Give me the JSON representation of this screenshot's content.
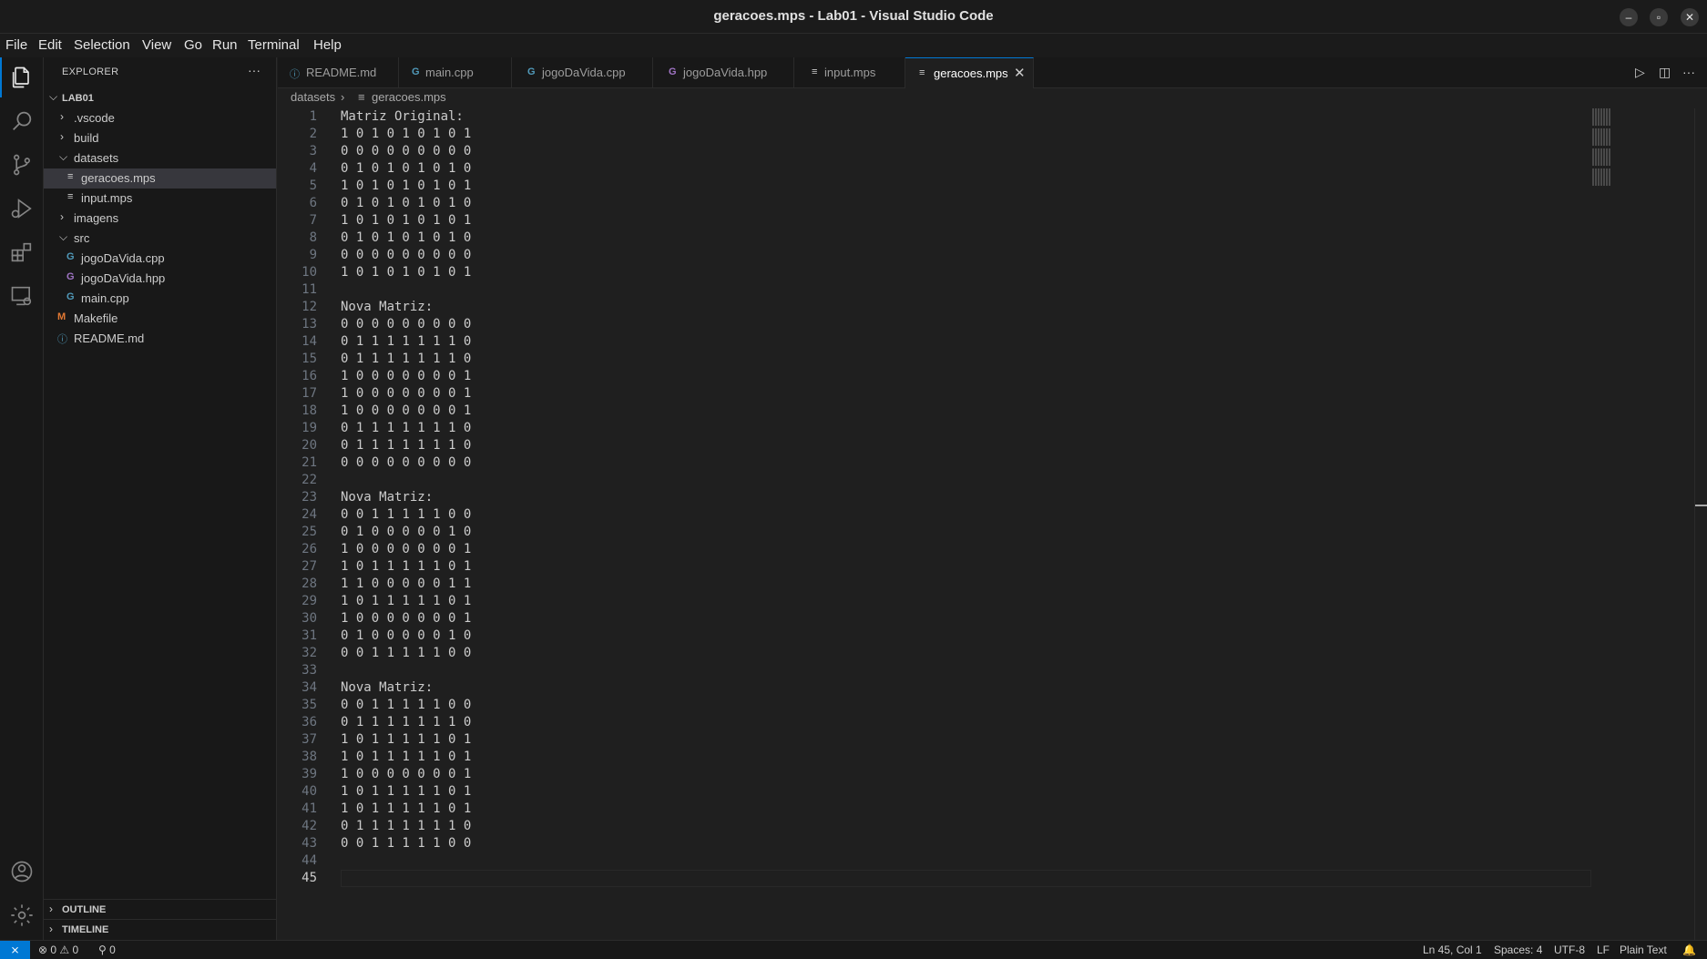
{
  "window": {
    "title": "geracoes.mps - Lab01 - Visual Studio Code",
    "controls": [
      "–",
      "▫",
      "✕"
    ]
  },
  "menu": [
    "File",
    "Edit",
    "Selection",
    "View",
    "Go",
    "Run",
    "Terminal",
    "Help"
  ],
  "activity_bar": [
    "files-icon",
    "search-icon",
    "source-control-icon",
    "run-debug-icon",
    "extensions-icon",
    "remote-explorer-icon",
    "accounts-icon",
    "settings-gear-icon"
  ],
  "sidebar": {
    "header": "EXPLORER",
    "more": "···",
    "root": "LAB01",
    "items": [
      {
        "label": ".vscode",
        "type": "folder",
        "expanded": false
      },
      {
        "label": "build",
        "type": "folder",
        "expanded": false
      },
      {
        "label": "datasets",
        "type": "folder",
        "expanded": true
      },
      {
        "label": "geracoes.mps",
        "type": "file",
        "icon": "≡",
        "selected": true
      },
      {
        "label": "input.mps",
        "type": "file",
        "icon": "≡"
      },
      {
        "label": "imagens",
        "type": "folder",
        "expanded": false
      },
      {
        "label": "src",
        "type": "folder",
        "expanded": true
      },
      {
        "label": "jogoDaVida.cpp",
        "type": "file",
        "icon": "G"
      },
      {
        "label": "jogoDaVida.hpp",
        "type": "file",
        "icon": "G"
      },
      {
        "label": "main.cpp",
        "type": "file",
        "icon": "G"
      },
      {
        "label": "Makefile",
        "type": "file",
        "icon": "M"
      },
      {
        "label": "README.md",
        "type": "file",
        "icon": "ⓘ"
      }
    ],
    "sections": [
      "OUTLINE",
      "TIMELINE"
    ]
  },
  "tabs": [
    {
      "label": "README.md",
      "icon": "ⓘ",
      "active": false
    },
    {
      "label": "main.cpp",
      "icon": "G",
      "active": false
    },
    {
      "label": "jogoDaVida.cpp",
      "icon": "G",
      "active": false
    },
    {
      "label": "jogoDaVida.hpp",
      "icon": "G",
      "active": false
    },
    {
      "label": "input.mps",
      "icon": "≡",
      "active": false
    },
    {
      "label": "geracoes.mps",
      "icon": "≡",
      "active": true,
      "close": "✕"
    }
  ],
  "tab_actions": [
    "▷",
    "◫",
    "···"
  ],
  "breadcrumb": {
    "folder": "datasets",
    "separator": "›",
    "file_icon": "≡",
    "file": "geracoes.mps"
  },
  "editor": {
    "lines": [
      "Matriz Original:",
      "1 0 1 0 1 0 1 0 1",
      "0 0 0 0 0 0 0 0 0",
      "0 1 0 1 0 1 0 1 0",
      "1 0 1 0 1 0 1 0 1",
      "0 1 0 1 0 1 0 1 0",
      "1 0 1 0 1 0 1 0 1",
      "0 1 0 1 0 1 0 1 0",
      "0 0 0 0 0 0 0 0 0",
      "1 0 1 0 1 0 1 0 1",
      "",
      "Nova Matriz:",
      "0 0 0 0 0 0 0 0 0",
      "0 1 1 1 1 1 1 1 0",
      "0 1 1 1 1 1 1 1 0",
      "1 0 0 0 0 0 0 0 1",
      "1 0 0 0 0 0 0 0 1",
      "1 0 0 0 0 0 0 0 1",
      "0 1 1 1 1 1 1 1 0",
      "0 1 1 1 1 1 1 1 0",
      "0 0 0 0 0 0 0 0 0",
      "",
      "Nova Matriz:",
      "0 0 1 1 1 1 1 0 0",
      "0 1 0 0 0 0 0 1 0",
      "1 0 0 0 0 0 0 0 1",
      "1 0 1 1 1 1 1 0 1",
      "1 1 0 0 0 0 0 1 1",
      "1 0 1 1 1 1 1 0 1",
      "1 0 0 0 0 0 0 0 1",
      "0 1 0 0 0 0 0 1 0",
      "0 0 1 1 1 1 1 0 0",
      "",
      "Nova Matriz:",
      "0 0 1 1 1 1 1 0 0",
      "0 1 1 1 1 1 1 1 0",
      "1 0 1 1 1 1 1 0 1",
      "1 0 1 1 1 1 1 0 1",
      "1 0 0 0 0 0 0 0 1",
      "1 0 1 1 1 1 1 0 1",
      "1 0 1 1 1 1 1 0 1",
      "0 1 1 1 1 1 1 1 0",
      "0 0 1 1 1 1 1 0 0",
      "",
      ""
    ],
    "current_line": 45
  },
  "status": {
    "remote": "⨯",
    "errors": "0",
    "warnings": "0",
    "ports": "0",
    "position": "Ln 45, Col 1",
    "spaces": "Spaces: 4",
    "encoding": "UTF-8",
    "eol": "LF",
    "language": "Plain Text",
    "bell": "🔔"
  },
  "colors": {
    "accent": "#0078d4",
    "cpp_icon": "#519aba",
    "hpp_icon": "#a074c4",
    "makefile_icon": "#e37933",
    "readme_icon": "#519aba"
  }
}
